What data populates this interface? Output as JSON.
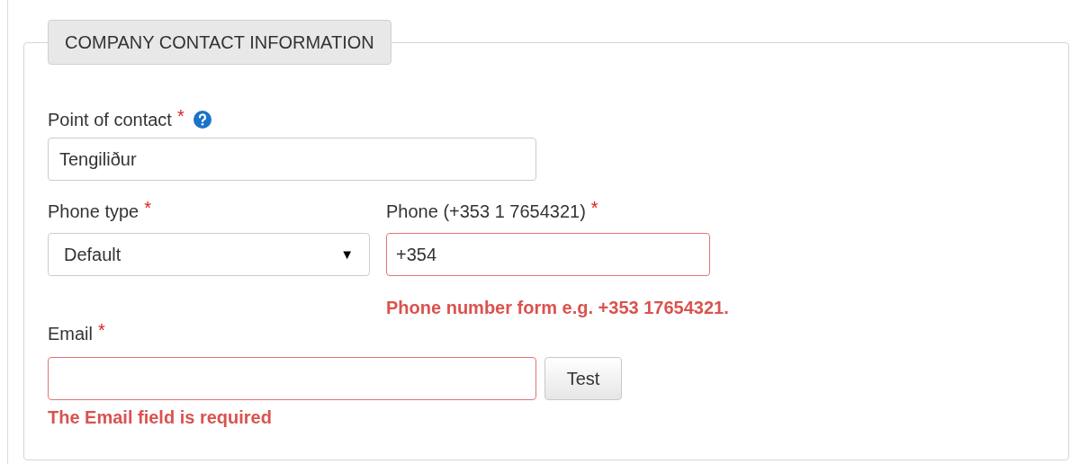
{
  "section": {
    "title": "COMPANY CONTACT INFORMATION"
  },
  "point_of_contact": {
    "label": "Point of contact",
    "required_mark": "*",
    "help": true,
    "value": "Tengiliður",
    "invalid": false
  },
  "phone_type": {
    "label": "Phone type",
    "required_mark": "*",
    "value": "Default",
    "caret": "▼",
    "invalid": false
  },
  "phone": {
    "label": "Phone (+353 1 7654321)",
    "required_mark": "*",
    "value": "+354",
    "invalid": true,
    "error": "Phone number form e.g. +353 17654321."
  },
  "email": {
    "label": "Email",
    "required_mark": "*",
    "invalid": true,
    "button": "Test",
    "error": "The Email field is required"
  }
}
